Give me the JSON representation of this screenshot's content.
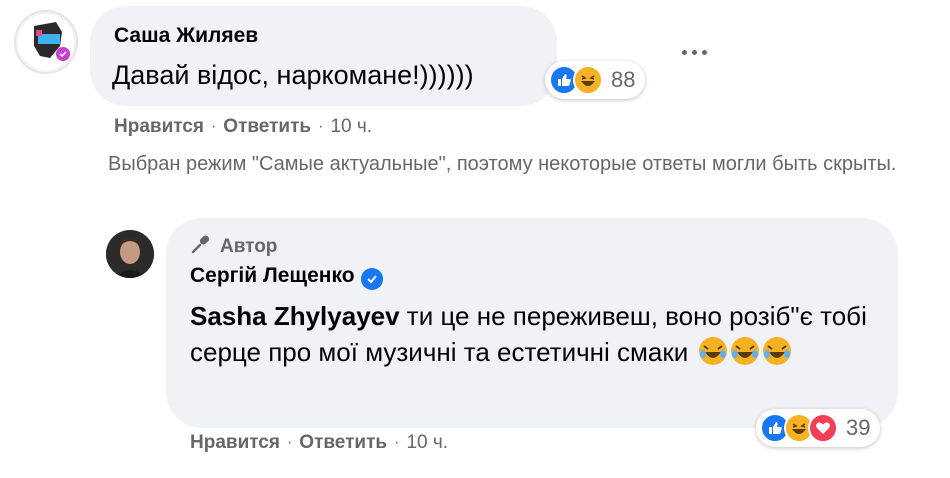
{
  "comment1": {
    "author": "Саша Жиляев",
    "text": "Давай відос, наркомане!))))))",
    "reaction_count": "88",
    "actions": {
      "like": "Нравится",
      "reply": "Ответить",
      "time": "10 ч."
    }
  },
  "notice": "Выбран режим \"Самые актуальные\", поэтому некоторые ответы могли быть скрыты.",
  "reply": {
    "badge": "Автор",
    "author": "Сергій Лещенко",
    "mention": "Sasha Zhylyayev",
    "text": " ти це не переживеш, воно розіб\"є тобі серце про мої музичні та естетичні смаки",
    "reaction_count": "39",
    "actions": {
      "like": "Нравится",
      "reply": "Ответить",
      "time": "10 ч."
    }
  },
  "colors": {
    "accent": "#1877f2",
    "bubble": "#f0f2f5",
    "muted": "#65676b",
    "haha": "#f7b125",
    "love": "#f33e58"
  },
  "icons": [
    "like-icon",
    "haha-icon",
    "love-icon",
    "verified-icon",
    "microphone-icon",
    "more-dots-icon"
  ]
}
